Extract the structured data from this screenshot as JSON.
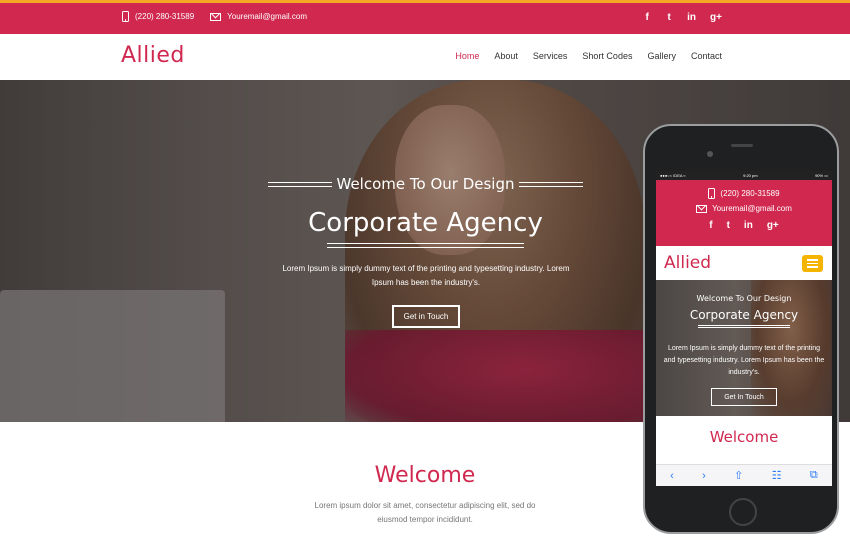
{
  "topbar": {
    "phone": "(220) 280-31589",
    "email": "Youremail@gmail.com",
    "social": [
      "f",
      "t",
      "in",
      "g+"
    ]
  },
  "navbar": {
    "logo": "Allied",
    "items": [
      "Home",
      "About",
      "Services",
      "Short Codes",
      "Gallery",
      "Contact"
    ],
    "active": "Home"
  },
  "hero": {
    "welcome": "Welcome To Our Design",
    "title": "Corporate Agency",
    "description": "Lorem Ipsum is simply dummy text of the printing and typesetting industry. Lorem Ipsum has been the industry's.",
    "cta": "Get in Touch"
  },
  "welcome_section": {
    "title": "Welcome",
    "description": "Lorem ipsum dolor sit amet, consectetur adipiscing elit, sed do eiusmod tempor incididunt."
  },
  "mobile": {
    "status_left": "●●●○○ IDEA ≈",
    "status_center": "9:20 pm",
    "status_right": "90% ▭",
    "phone": "(220) 280-31589",
    "email": "Youremail@gmail.com",
    "social": [
      "f",
      "t",
      "in",
      "g+"
    ],
    "logo": "Allied",
    "welcome": "Welcome To Our Design",
    "title": "Corporate Agency",
    "description": "Lorem Ipsum is simply dummy text of the printing and typesetting industry. Lorem Ipsum has been the industry's.",
    "cta": "Get In Touch",
    "section_title": "Welcome",
    "toolbar": [
      "‹",
      "›",
      "⇧",
      "☷",
      "⧉"
    ]
  },
  "colors": {
    "primary": "#d0284f",
    "accent": "#f5a623",
    "menu_button": "#f5b400"
  }
}
